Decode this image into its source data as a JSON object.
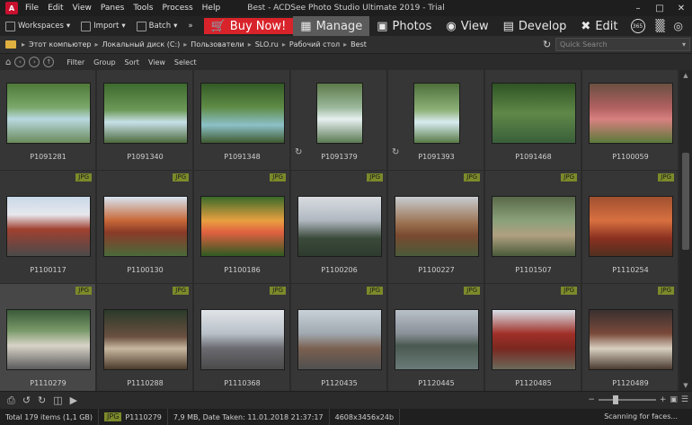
{
  "titlebar": {
    "app_icon_text": "A",
    "menu": [
      "File",
      "Edit",
      "View",
      "Panes",
      "Tools",
      "Process",
      "Help"
    ],
    "title": "Best - ACDSee Photo Studio Ultimate 2019 - Trial"
  },
  "toolbar": {
    "workspaces": "Workspaces",
    "import": "Import",
    "batch": "Batch",
    "buy_now": "Buy Now!",
    "modes": [
      "Manage",
      "Photos",
      "View",
      "Develop",
      "Edit"
    ],
    "active_mode": "Manage",
    "icon_365": "365"
  },
  "address": {
    "crumbs": [
      "Этот компьютер",
      "Локальный диск (C:)",
      "Пользователи",
      "SLO.ru",
      "Рабочий стол",
      "Best"
    ],
    "quick_search_placeholder": "Quick Search"
  },
  "filterbar": [
    "Filter",
    "Group",
    "Sort",
    "View",
    "Select"
  ],
  "badge_label": "JPG",
  "files": [
    {
      "name": "P1091281",
      "badge": false,
      "rotate": false
    },
    {
      "name": "P1091340",
      "badge": false,
      "rotate": false
    },
    {
      "name": "P1091348",
      "badge": false,
      "rotate": false
    },
    {
      "name": "P1091379",
      "badge": false,
      "rotate": true
    },
    {
      "name": "P1091393",
      "badge": false,
      "rotate": true
    },
    {
      "name": "P1091468",
      "badge": false,
      "rotate": false
    },
    {
      "name": "P1100059",
      "badge": false,
      "rotate": false
    },
    {
      "name": "P1100117",
      "badge": true,
      "rotate": false
    },
    {
      "name": "P1100130",
      "badge": true,
      "rotate": false
    },
    {
      "name": "P1100186",
      "badge": true,
      "rotate": false
    },
    {
      "name": "P1100206",
      "badge": true,
      "rotate": false
    },
    {
      "name": "P1100227",
      "badge": true,
      "rotate": false
    },
    {
      "name": "P1101507",
      "badge": true,
      "rotate": false
    },
    {
      "name": "P1110254",
      "badge": true,
      "rotate": false
    },
    {
      "name": "P1110279",
      "badge": true,
      "rotate": false
    },
    {
      "name": "P1110288",
      "badge": true,
      "rotate": false
    },
    {
      "name": "P1110368",
      "badge": true,
      "rotate": false
    },
    {
      "name": "P1120435",
      "badge": true,
      "rotate": false
    },
    {
      "name": "P1120445",
      "badge": true,
      "rotate": false
    },
    {
      "name": "P1120485",
      "badge": true,
      "rotate": false
    },
    {
      "name": "P1120489",
      "badge": true,
      "rotate": false
    }
  ],
  "selected_file": "P1110279",
  "status": {
    "total": "Total 179 items  (1,1 GB)",
    "file_type": "JPG",
    "file_name": "P1110279",
    "details": "7,9 MB, Date Taken: 11.01.2018 21:37:17",
    "dimensions": "4608x3456x24b",
    "scanning": "Scanning for faces..."
  },
  "colors": {
    "accent_red": "#d8232a",
    "badge_green": "#7c8a2a",
    "background": "#2b2b2b"
  }
}
